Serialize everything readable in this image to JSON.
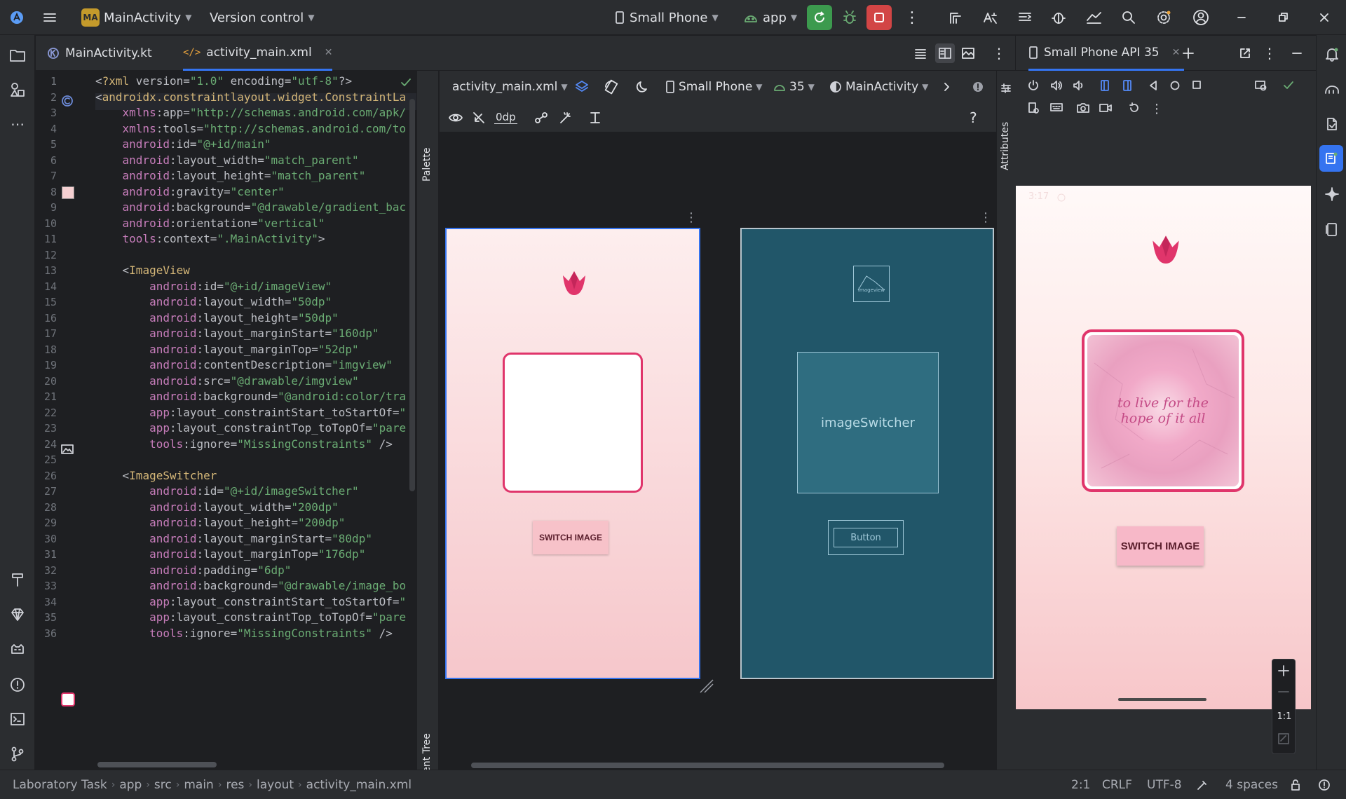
{
  "titlebar": {
    "project_badge": "MA",
    "project_name": "MainActivity",
    "vcs": "Version control",
    "device": "Small Phone",
    "run_config": "app"
  },
  "editor": {
    "tabs": [
      {
        "label": "MainActivity.kt",
        "active": false
      },
      {
        "label": "activity_main.xml",
        "active": true
      }
    ]
  },
  "code": {
    "line_numbers": [
      "1",
      "2",
      "3",
      "4",
      "5",
      "6",
      "7",
      "8",
      "9",
      "10",
      "11",
      "12",
      "13",
      "14",
      "15",
      "16",
      "17",
      "18",
      "19",
      "20",
      "21",
      "22",
      "23",
      "24",
      "25",
      "26",
      "27",
      "28",
      "29",
      "30",
      "31",
      "32",
      "33",
      "34",
      "35",
      "36"
    ],
    "lines": [
      "<?xml version=\"1.0\" encoding=\"utf-8\"?>",
      "<androidx.constraintlayout.widget.ConstraintLa",
      "    xmlns:app=\"http://schemas.android.com/apk/",
      "    xmlns:tools=\"http://schemas.android.com/to",
      "    android:id=\"@+id/main\"",
      "    android:layout_width=\"match_parent\"",
      "    android:layout_height=\"match_parent\"",
      "    android:gravity=\"center\"",
      "    android:background=\"@drawable/gradient_bac",
      "    android:orientation=\"vertical\"",
      "    tools:context=\".MainActivity\">",
      "",
      "    <ImageView",
      "        android:id=\"@+id/imageView\"",
      "        android:layout_width=\"50dp\"",
      "        android:layout_height=\"50dp\"",
      "        android:layout_marginStart=\"160dp\"",
      "        android:layout_marginTop=\"52dp\"",
      "        android:contentDescription=\"imgview\"",
      "        android:src=\"@drawable/imgview\"",
      "        android:background=\"@android:color/tra",
      "        app:layout_constraintStart_toStartOf=\"",
      "        app:layout_constraintTop_toTopOf=\"pare",
      "        tools:ignore=\"MissingConstraints\" />",
      "",
      "    <ImageSwitcher",
      "        android:id=\"@+id/imageSwitcher\"",
      "        android:layout_width=\"200dp\"",
      "        android:layout_height=\"200dp\"",
      "        android:layout_marginStart=\"80dp\"",
      "        android:layout_marginTop=\"176dp\"",
      "        android:padding=\"6dp\"",
      "        android:background=\"@drawable/image_bo",
      "        app:layout_constraintStart_toStartOf=\"",
      "        app:layout_constraintTop_toTopOf=\"pare",
      "        tools:ignore=\"MissingConstraints\" />"
    ]
  },
  "side_panels": {
    "palette": "Palette",
    "component_tree": "Component Tree",
    "attributes": "Attributes"
  },
  "design": {
    "file": "activity_main.xml",
    "device": "Small Phone",
    "api": "35",
    "theme": "MainActivity",
    "margin": "0dp",
    "preview_button": "SWITCH IMAGE",
    "blueprint_switcher_label": "imageSwitcher",
    "blueprint_image_label": "imageview",
    "blueprint_button_label": "Button"
  },
  "running_devices": {
    "tab": "Small Phone API 35",
    "clock": "3:17",
    "card_text_line1": "to live for the",
    "card_text_line2": "hope of it all",
    "button": "SWITCH IMAGE",
    "zoom_label": "1:1"
  },
  "statusbar": {
    "breadcrumbs": [
      "Laboratory Task",
      "app",
      "src",
      "main",
      "res",
      "layout",
      "activity_main.xml"
    ],
    "position": "2:1",
    "line_sep": "CRLF",
    "encoding": "UTF-8",
    "indent": "4 spaces"
  },
  "colors": {
    "accent": "#3574f0",
    "run_green": "#3c9a4e",
    "stop_red": "#d24545",
    "tulip": "#e0356b",
    "blueprint": "#215669"
  }
}
